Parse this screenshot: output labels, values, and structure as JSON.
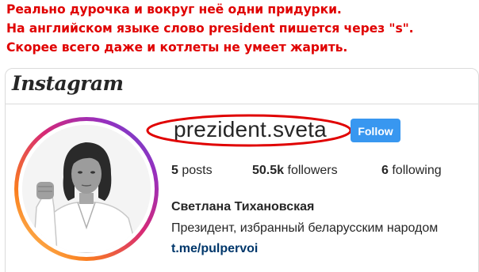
{
  "caption": {
    "lines": [
      "Реально дурочка и вокруг неё одни придурки.",
      "На английском языке слово president пишется через \"s\".",
      "Скорее всего даже и котлеты не умеет жарить."
    ],
    "color": "#e00000"
  },
  "app": {
    "logo_text": "Instagram"
  },
  "profile": {
    "username": "prezident.sveta",
    "follow_label": "Follow",
    "stats": {
      "posts_count": "5",
      "posts_label": "posts",
      "followers_count": "50.5k",
      "followers_label": "followers",
      "following_count": "6",
      "following_label": "following"
    },
    "full_name": "Светлана Тихановская",
    "bio": "Президент, избранный беларусским народом",
    "link": "t.me/pulpervoi"
  },
  "colors": {
    "follow_button": "#3897f0",
    "link": "#00376b",
    "annotation_ellipse": "#e00000"
  }
}
